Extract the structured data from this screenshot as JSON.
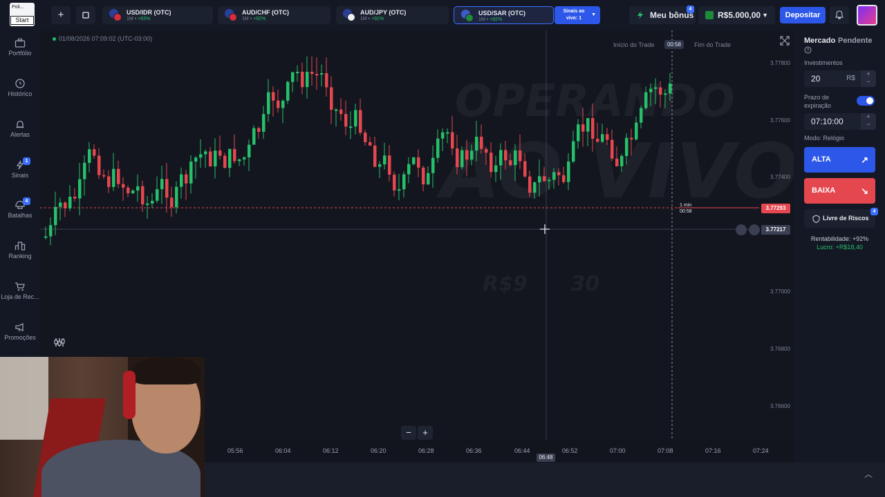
{
  "topbar": {
    "logo_text": "Poli...",
    "start_label": "Start",
    "add_label": "+",
    "assets": [
      {
        "name": "USD/IDR (OTC)",
        "interval": "1M •",
        "payout": "+93%",
        "c1": "#d62b3b",
        "c2": "#f1f1f1"
      },
      {
        "name": "AUD/CHF (OTC)",
        "interval": "1M •",
        "payout": "+92%",
        "c1": "#2a3f9a",
        "c2": "#d62b3b"
      },
      {
        "name": "AUD/JPY (OTC)",
        "interval": "1M •",
        "payout": "+92%",
        "c1": "#2a3f9a",
        "c2": "#f1f1f1"
      },
      {
        "name": "USD/SAR (OTC)",
        "interval": "1M •",
        "payout": "+92%",
        "c1": "#3c5cc8",
        "c2": "#1e8a3c"
      }
    ],
    "signals_line1": "Sinais ao",
    "signals_line2": "vivo: 1",
    "bonus_label": "Meu bônus",
    "bonus_badge": "4",
    "balance": "R$5.000,00",
    "deposit_label": "Depositar"
  },
  "sidebar": {
    "items": [
      {
        "label": "Portfólio",
        "icon": "briefcase-icon"
      },
      {
        "label": "Histórico",
        "icon": "clock-icon"
      },
      {
        "label": "Alertas",
        "icon": "alarm-icon"
      },
      {
        "label": "Sinais",
        "icon": "lightning-icon",
        "badge": "1"
      },
      {
        "label": "Batalhas",
        "icon": "helmet-icon",
        "badge": "4"
      },
      {
        "label": "Ranking",
        "icon": "podium-icon"
      },
      {
        "label": "Loja de Rec...",
        "icon": "cart-icon"
      },
      {
        "label": "Promoções",
        "icon": "megaphone-icon"
      }
    ]
  },
  "chart": {
    "timestamp": "01/08/2026 07:09:02 (UTC-03:00)",
    "trade_start": "Início do Trade",
    "trade_timer": "00:58",
    "trade_end": "Fim do Trade",
    "current_price": "3.77293",
    "hover_price": "3.77217",
    "one_min_line1": "1 min",
    "one_min_line2": "00:58",
    "background_text_1": "OPERANDO",
    "background_text_2": "AO VIVO",
    "background_text_3": "R$9",
    "background_text_4": "30",
    "y_labels": [
      "3.77800",
      "3.77600",
      "3.77400",
      "3.77000",
      "3.76800",
      "3.76600"
    ],
    "x_labels": [
      "05:56",
      "06:04",
      "06:12",
      "06:20",
      "06:28",
      "06:36",
      "06:44",
      "06:52",
      "07:00",
      "07:08",
      "07:16",
      "07:24"
    ],
    "x_cursor": "06:48",
    "zoom_out": "−",
    "zoom_in": "+"
  },
  "panel": {
    "tab_market": "Mercado",
    "tab_pending": "Pendente",
    "invest_label": "Investimentos",
    "invest_value": "20",
    "invest_currency": "R$",
    "expiry_label": "Prazo de expiração",
    "expiry_value": "07:10:00",
    "mode_label": "Modo: Relógio",
    "up_label": "ALTA",
    "down_label": "BAIXA",
    "risk_label": "Livre de Riscos",
    "risk_badge": "4",
    "profitability": "Rentabilidade: +92%",
    "profit": "Lucro: +R$18,40"
  },
  "colors": {
    "up": "#26c06a",
    "down": "#e5474f",
    "accent": "#2c57e8"
  }
}
